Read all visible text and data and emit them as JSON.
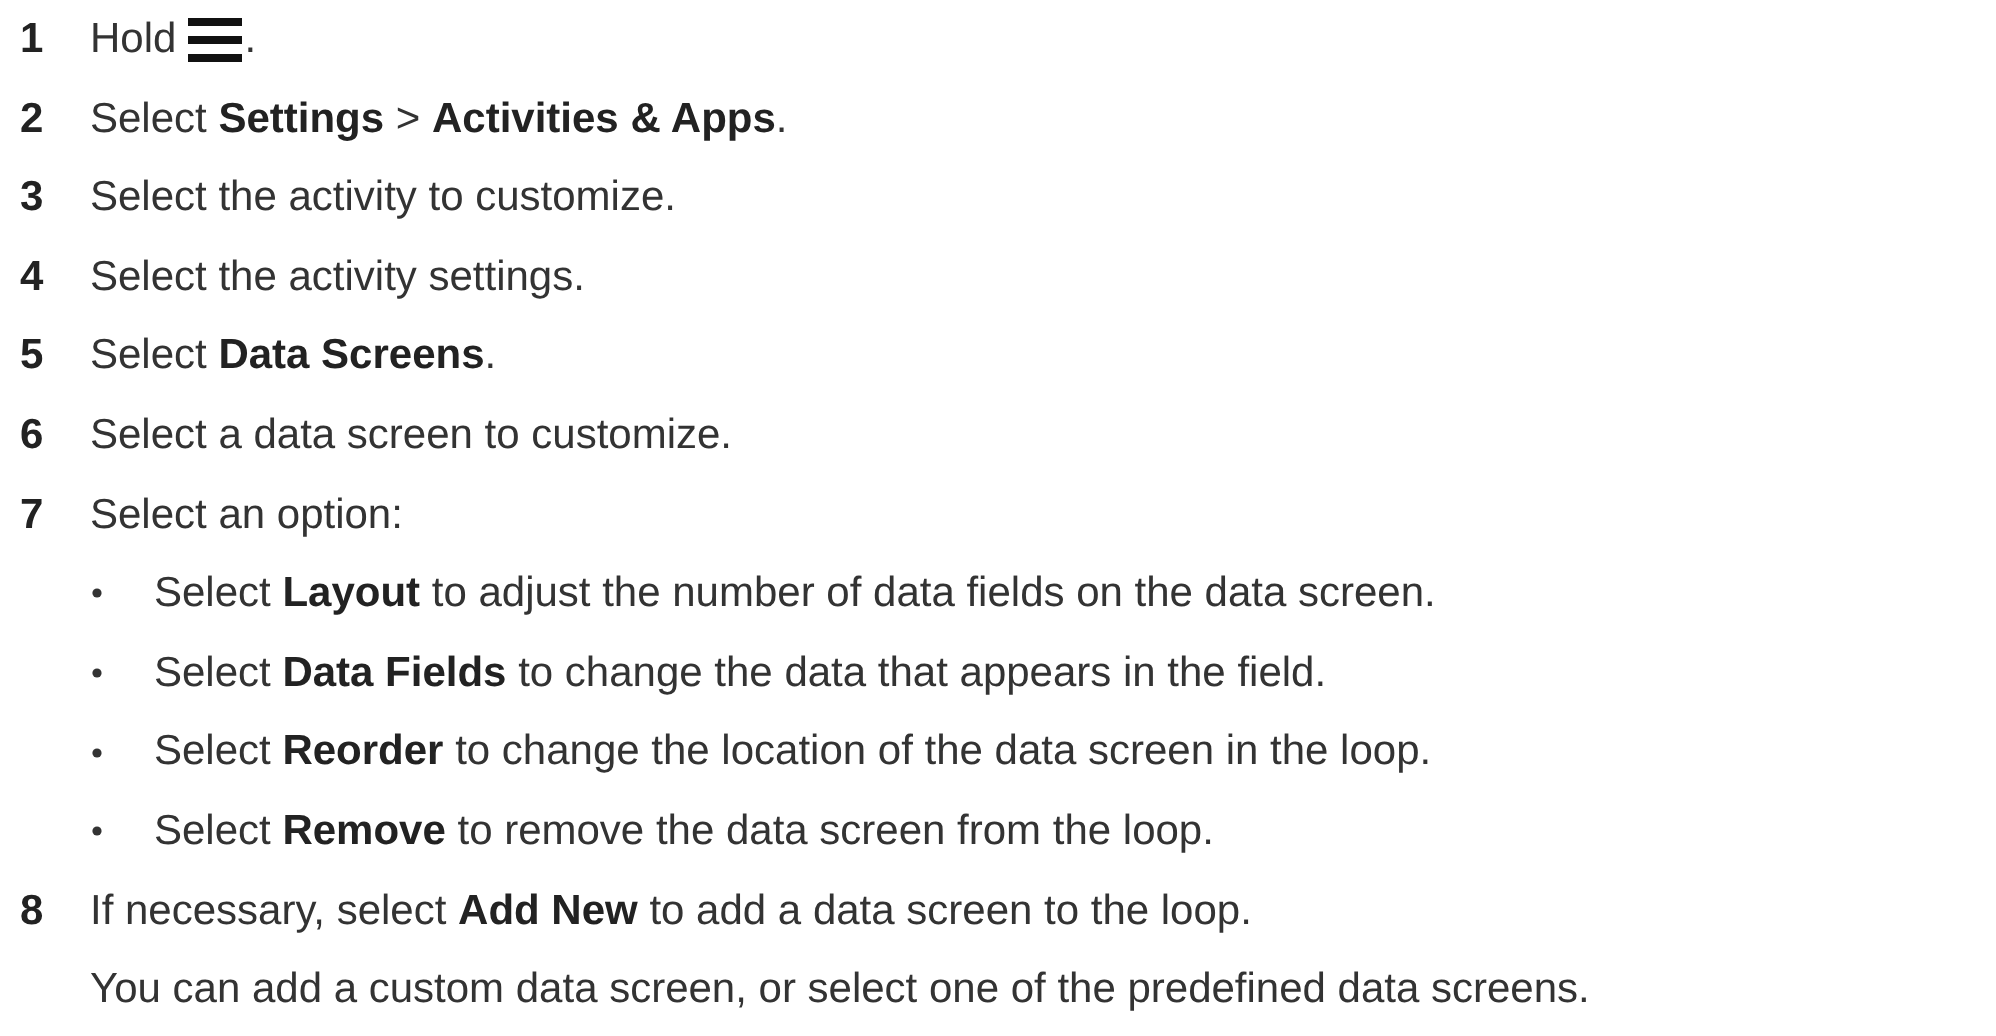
{
  "steps": [
    {
      "number": "1",
      "kind": "icon",
      "text": "Hold",
      "suffix": "."
    },
    {
      "number": "2",
      "kind": "text",
      "text": "Select **Settings** > **Activities & Apps**."
    },
    {
      "number": "3",
      "kind": "text",
      "text": "Select the activity to customize."
    },
    {
      "number": "4",
      "kind": "text",
      "text": "Select the activity settings."
    },
    {
      "number": "5",
      "kind": "text",
      "text": "Select **Data Screens**."
    },
    {
      "number": "6",
      "kind": "text",
      "text": "Select a data screen to customize."
    },
    {
      "number": "7",
      "kind": "text",
      "text": "Select an option:",
      "bullets": [
        "Select **Layout** to adjust the number of data fields on the data screen.",
        "Select **Data Fields** to change the data that appears in the field.",
        "Select **Reorder** to change the location of the data screen in the loop.",
        "Select **Remove** to remove the data screen from the loop."
      ]
    },
    {
      "number": "8",
      "kind": "text",
      "text": "If necessary, select **Add New** to add a data screen to the loop.",
      "note": "You can add a custom data screen, or select one of the predefined data screens."
    }
  ]
}
